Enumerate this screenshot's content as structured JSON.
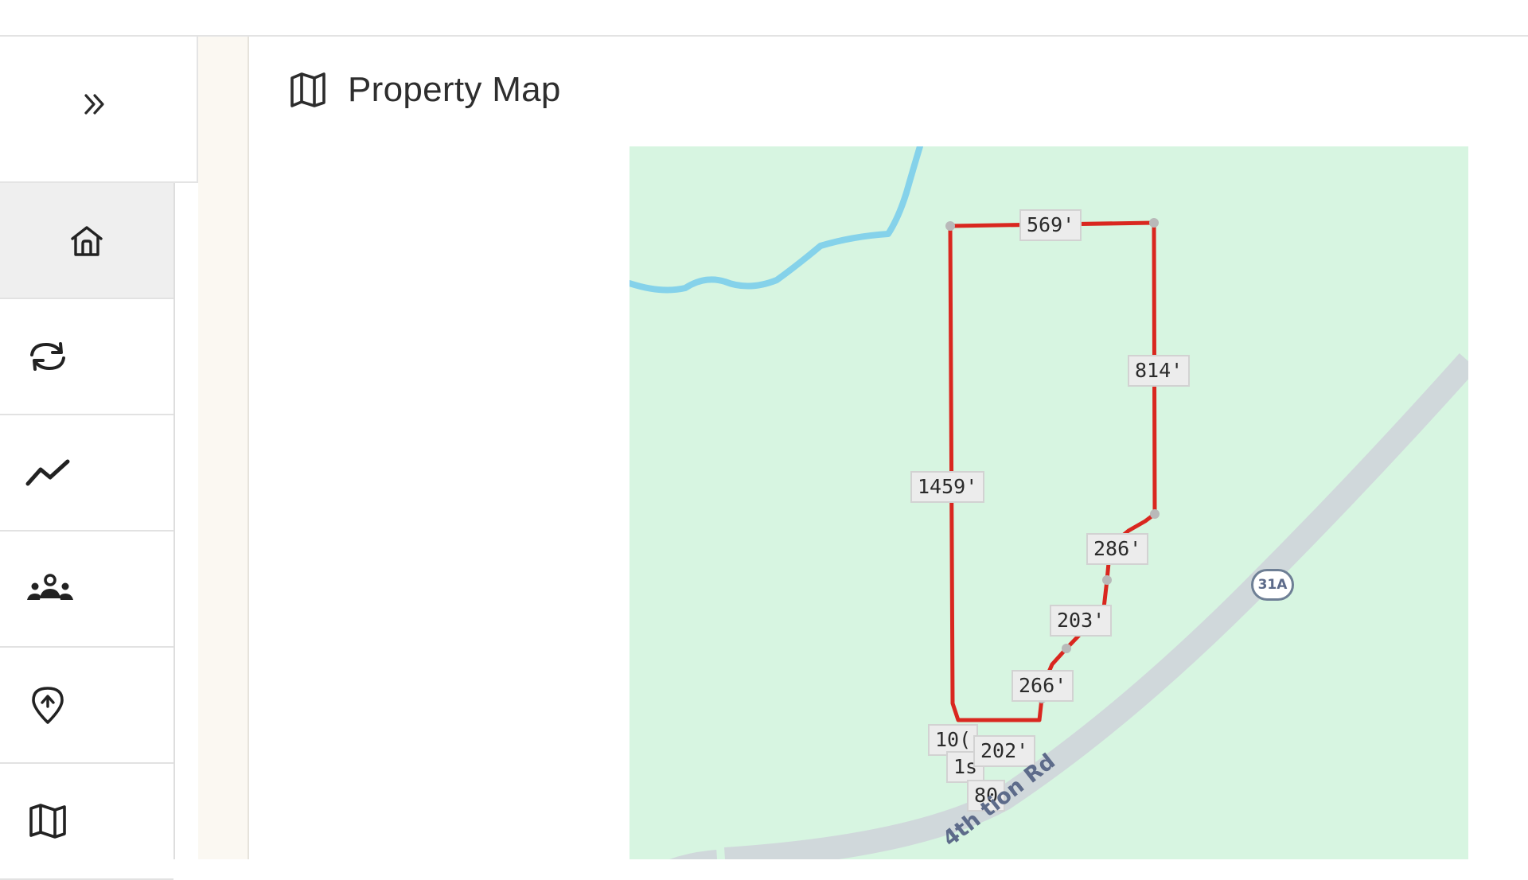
{
  "page": {
    "title": "Property Map"
  },
  "sidebar": {
    "collapse_icon": "double-chevron-right-icon",
    "items": [
      {
        "name": "home",
        "icon": "home-icon",
        "active": true
      },
      {
        "name": "sync",
        "icon": "refresh-icon",
        "active": false
      },
      {
        "name": "analytics",
        "icon": "trend-line-icon",
        "active": false
      },
      {
        "name": "people",
        "icon": "people-group-icon",
        "active": false
      },
      {
        "name": "location",
        "icon": "location-pin-icon",
        "active": false
      },
      {
        "name": "map",
        "icon": "map-icon",
        "active": false
      }
    ]
  },
  "map": {
    "segment_labels": [
      "569'",
      "814'",
      "1459'",
      "286'",
      "203'",
      "266'",
      "10(",
      "202'",
      "1s",
      "80"
    ],
    "road_name": "4th   tion Rd",
    "route_shield": "31A",
    "colors": {
      "land": "#d7f5e1",
      "water": "#85d2ea",
      "road": "#d3dbde",
      "boundary": "#d9271f",
      "vertex": "#b9b9b9"
    }
  }
}
